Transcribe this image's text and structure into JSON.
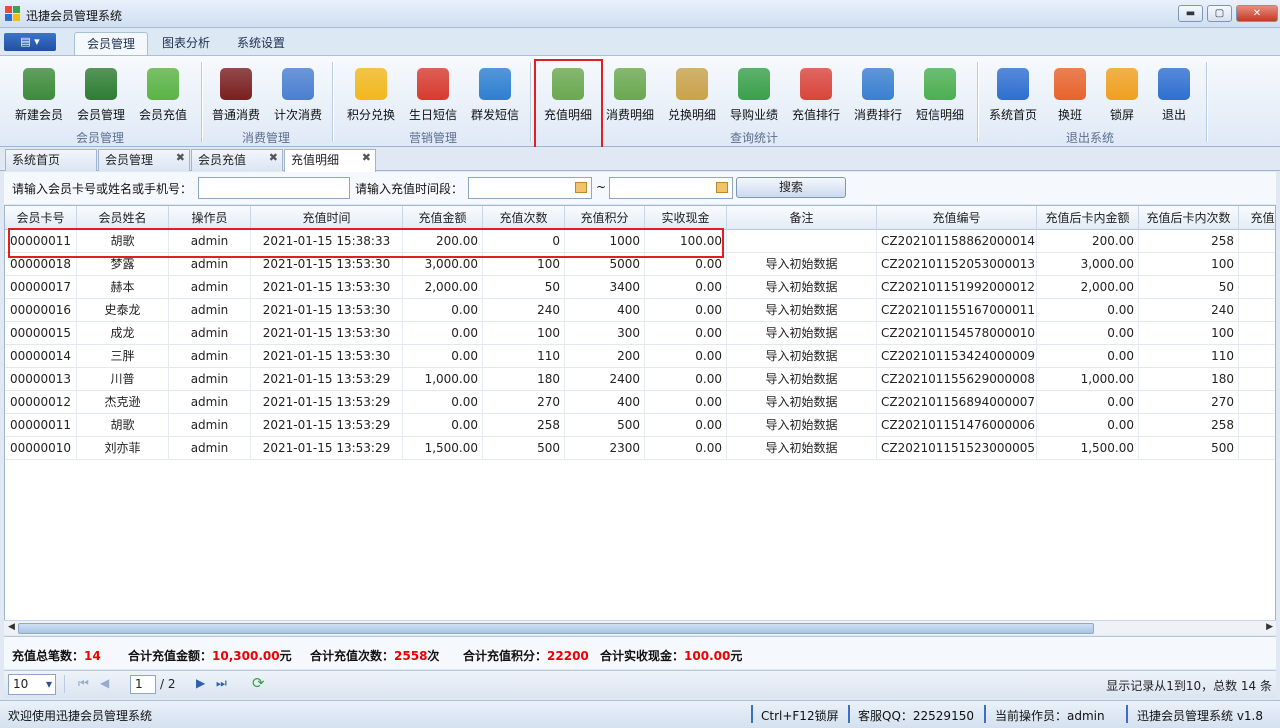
{
  "window": {
    "title": "迅捷会员管理系统",
    "min": "▬",
    "max": "▢",
    "close": "✕"
  },
  "menu": {
    "app_button": "▤ ▾",
    "tabs": [
      "会员管理",
      "图表分析",
      "系统设置"
    ]
  },
  "ribbon": {
    "buttons": [
      {
        "label": "新建会员",
        "icon": "new-member-icon",
        "color": "#3d8a3a"
      },
      {
        "label": "会员管理",
        "icon": "member-book-icon",
        "color": "#2e7d32"
      },
      {
        "label": "会员充值",
        "icon": "recharge-drop-icon",
        "color": "#5bb345"
      },
      {
        "label": "普通消费",
        "icon": "cash-register-icon",
        "color": "#7a1f1f"
      },
      {
        "label": "计次消费",
        "icon": "calendar-plus-icon",
        "color": "#4a7fd0"
      },
      {
        "label": "积分兑换",
        "icon": "points-hex-icon",
        "color": "#f2b81c"
      },
      {
        "label": "生日短信",
        "icon": "sms-red-icon",
        "color": "#d83a2e"
      },
      {
        "label": "群发短信",
        "icon": "sms-blue-icon",
        "color": "#2d7fd0"
      },
      {
        "label": "充值明细",
        "icon": "recharge-detail-icon",
        "color": "#6aa84f"
      },
      {
        "label": "消费明细",
        "icon": "consume-detail-icon",
        "color": "#6aa84f"
      },
      {
        "label": "兑换明细",
        "icon": "exchange-detail-icon",
        "color": "#c9a24a"
      },
      {
        "label": "导购业绩",
        "icon": "sales-chart-icon",
        "color": "#3aa04a"
      },
      {
        "label": "充值排行",
        "icon": "bar-rank-icon",
        "color": "#d9453b"
      },
      {
        "label": "消费排行",
        "icon": "bar-rank2-icon",
        "color": "#3a7fd0"
      },
      {
        "label": "短信明细",
        "icon": "sms-detail-icon",
        "color": "#4caf50"
      },
      {
        "label": "系统首页",
        "icon": "compass-home-icon",
        "color": "#2f6fd0"
      },
      {
        "label": "换班",
        "icon": "swap-shift-icon",
        "color": "#e8632b"
      },
      {
        "label": "锁屏",
        "icon": "lock-icon",
        "color": "#f0a020"
      },
      {
        "label": "退出",
        "icon": "power-icon",
        "color": "#2f6fd0"
      }
    ],
    "groups": [
      "会员管理",
      "消费管理",
      "营销管理",
      "查询统计",
      "退出系统"
    ]
  },
  "doc_tabs": [
    "系统首页",
    "会员管理",
    "会员充值",
    "充值明细"
  ],
  "search": {
    "label1": "请输入会员卡号或姓名或手机号：",
    "label2": "请输入充值时间段：",
    "tilde": "~",
    "button": "搜索"
  },
  "table": {
    "headers": [
      "会员卡号",
      "会员姓名",
      "操作员",
      "充值时间",
      "充值金额",
      "充值次数",
      "充值积分",
      "实收现金",
      "备注",
      "充值编号",
      "充值后卡内金额",
      "充值后卡内次数",
      "充值后"
    ],
    "rows": [
      [
        "00000011",
        "胡歌",
        "admin",
        "2021-01-15 15:38:33",
        "200.00",
        "0",
        "1000",
        "100.00",
        "",
        "CZ202101158862000014",
        "200.00",
        "258"
      ],
      [
        "00000018",
        "梦露",
        "admin",
        "2021-01-15 13:53:30",
        "3,000.00",
        "100",
        "5000",
        "0.00",
        "导入初始数据",
        "CZ202101152053000013",
        "3,000.00",
        "100"
      ],
      [
        "00000017",
        "赫本",
        "admin",
        "2021-01-15 13:53:30",
        "2,000.00",
        "50",
        "3400",
        "0.00",
        "导入初始数据",
        "CZ202101151992000012",
        "2,000.00",
        "50"
      ],
      [
        "00000016",
        "史泰龙",
        "admin",
        "2021-01-15 13:53:30",
        "0.00",
        "240",
        "400",
        "0.00",
        "导入初始数据",
        "CZ202101155167000011",
        "0.00",
        "240"
      ],
      [
        "00000015",
        "成龙",
        "admin",
        "2021-01-15 13:53:30",
        "0.00",
        "100",
        "300",
        "0.00",
        "导入初始数据",
        "CZ202101154578000010",
        "0.00",
        "100"
      ],
      [
        "00000014",
        "三胖",
        "admin",
        "2021-01-15 13:53:30",
        "0.00",
        "110",
        "200",
        "0.00",
        "导入初始数据",
        "CZ202101153424000009",
        "0.00",
        "110"
      ],
      [
        "00000013",
        "川普",
        "admin",
        "2021-01-15 13:53:29",
        "1,000.00",
        "180",
        "2400",
        "0.00",
        "导入初始数据",
        "CZ202101155629000008",
        "1,000.00",
        "180"
      ],
      [
        "00000012",
        "杰克逊",
        "admin",
        "2021-01-15 13:53:29",
        "0.00",
        "270",
        "400",
        "0.00",
        "导入初始数据",
        "CZ202101156894000007",
        "0.00",
        "270"
      ],
      [
        "00000011",
        "胡歌",
        "admin",
        "2021-01-15 13:53:29",
        "0.00",
        "258",
        "500",
        "0.00",
        "导入初始数据",
        "CZ202101151476000006",
        "0.00",
        "258"
      ],
      [
        "00000010",
        "刘亦菲",
        "admin",
        "2021-01-15 13:53:29",
        "1,500.00",
        "500",
        "2300",
        "0.00",
        "导入初始数据",
        "CZ202101151523000005",
        "1,500.00",
        "500"
      ]
    ]
  },
  "summary": {
    "count_label": "充值总笔数：",
    "count": "14",
    "amount_label": "合计充值金额：",
    "amount": "10,300.00",
    "amount_unit": "元",
    "times_label": "合计充值次数：",
    "times": "2558",
    "times_unit": "次",
    "points_label": "合计充值积分：",
    "points": "22200",
    "cash_label": "合计实收现金：",
    "cash": "100.00",
    "cash_unit": "元"
  },
  "pager": {
    "page_size": "10",
    "page": "1",
    "total": "/ 2",
    "info": "显示记录从1到10，总数 14 条"
  },
  "status": {
    "welcome": "欢迎使用迅捷会员管理系统",
    "lock_hint": "Ctrl+F12锁屏",
    "qq": "客服QQ：22529150",
    "operator": "当前操作员：admin",
    "version": "迅捷会员管理系统 v1.8"
  }
}
